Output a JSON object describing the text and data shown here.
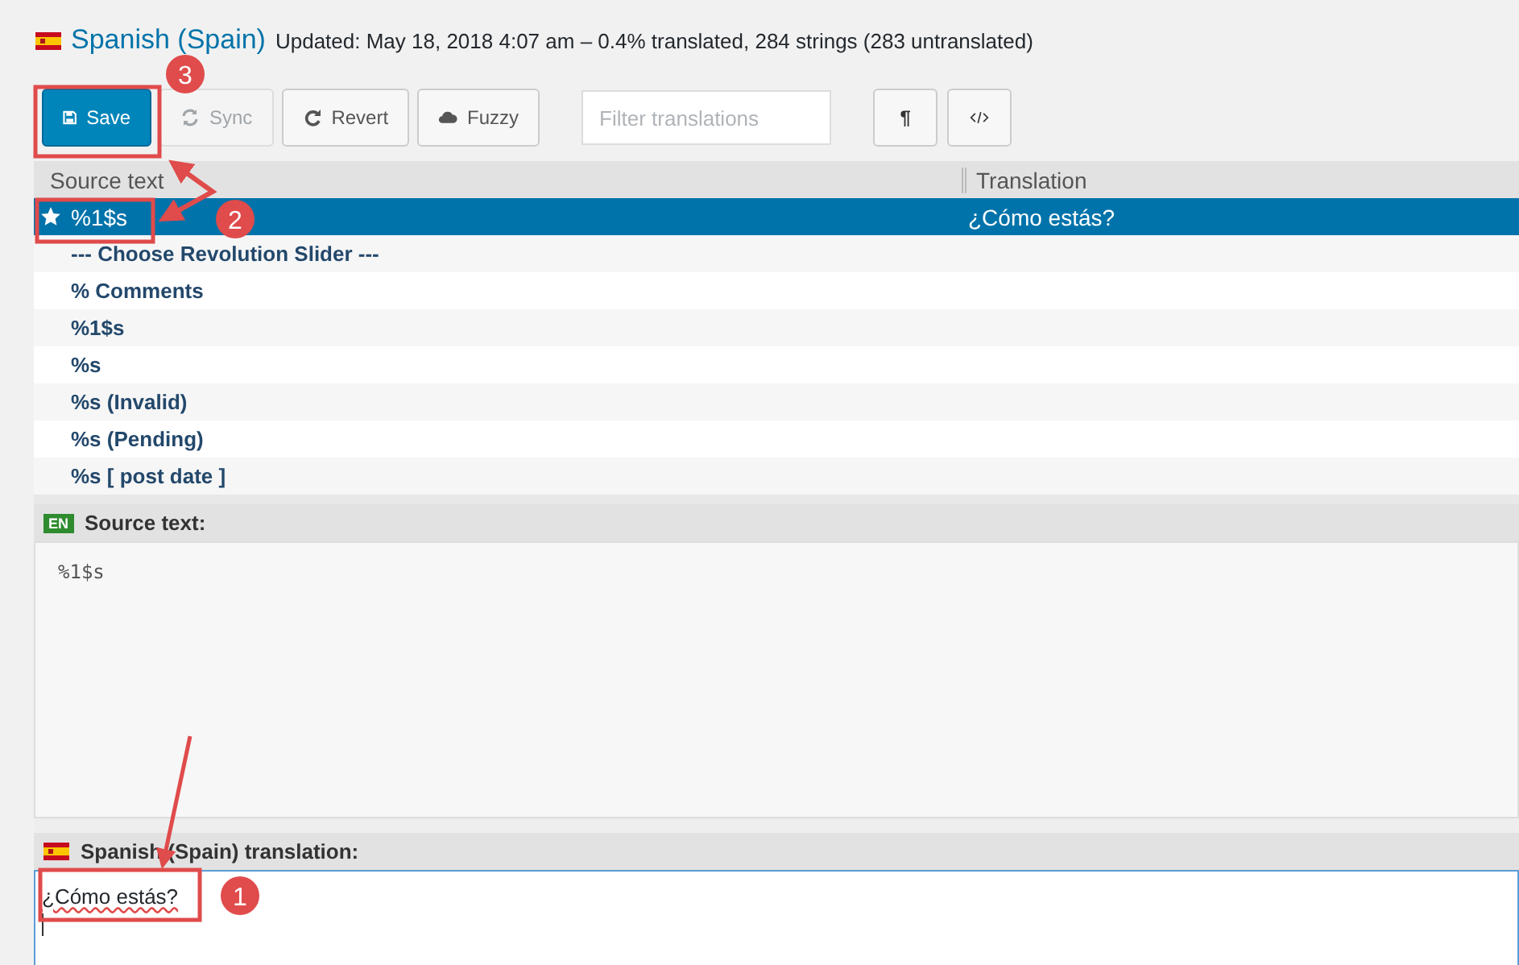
{
  "header": {
    "language": "Spanish (Spain)",
    "meta": "Updated: May 18, 2018 4:07 am – 0.4% translated, 284 strings (283 untranslated)"
  },
  "toolbar": {
    "buttons": [
      {
        "label": "Save",
        "kind": "primary",
        "disabled": false
      },
      {
        "label": "Sync",
        "kind": "normal",
        "disabled": true
      },
      {
        "label": "Revert",
        "kind": "normal",
        "disabled": false
      },
      {
        "label": "Fuzzy",
        "kind": "normal",
        "disabled": false
      }
    ],
    "filter": {
      "placeholder": "Filter translations"
    },
    "tools": [
      {
        "kind": "text",
        "label": "¶"
      },
      {
        "kind": "code"
      }
    ]
  },
  "table": {
    "columns": [
      "Source text",
      "Translation"
    ],
    "rows": [
      {
        "source": "%1$s",
        "translation": "¿Cómo estás?",
        "selected": true,
        "starred": true
      },
      {
        "source": "--- Choose Revolution Slider ---",
        "selected": false,
        "starred": false
      },
      {
        "source": "% Comments",
        "selected": false,
        "starred": false
      },
      {
        "source": "%1$s",
        "selected": false,
        "starred": false
      },
      {
        "source": "%s",
        "selected": false,
        "starred": false
      },
      {
        "source": "%s (Invalid)",
        "selected": false,
        "starred": false
      },
      {
        "source": "%s (Pending)",
        "selected": false,
        "starred": false
      },
      {
        "source": "%s [ post date ]",
        "selected": false,
        "starred": false
      }
    ]
  },
  "source_panel": {
    "badge": "EN",
    "title": "Source text:",
    "text": "%1$s"
  },
  "translation_panel": {
    "title": "Spanish (Spain) translation:",
    "value": "¿Cómo estás?"
  },
  "annotations": [
    "1",
    "2",
    "3"
  ]
}
